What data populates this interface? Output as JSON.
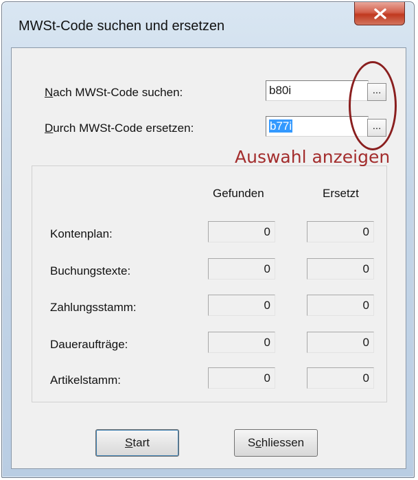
{
  "window": {
    "title": "MWSt-Code suchen und ersetzen",
    "close_icon": "close-icon"
  },
  "search": {
    "label_accel": "N",
    "label_rest": "ach MWSt-Code suchen:",
    "value": "b80i",
    "browse_label": "..."
  },
  "replace": {
    "label_accel": "D",
    "label_rest": "urch MWSt-Code ersetzen:",
    "value": "b77i",
    "browse_label": "..."
  },
  "annotation": {
    "text": "Auswahl anzeigen",
    "color": "#a32d2d"
  },
  "results": {
    "col_found": "Gefunden",
    "col_replaced": "Ersetzt",
    "rows": [
      {
        "label": "Kontenplan:",
        "found": "0",
        "replaced": "0"
      },
      {
        "label": "Buchungstexte:",
        "found": "0",
        "replaced": "0"
      },
      {
        "label": "Zahlungsstamm:",
        "found": "0",
        "replaced": "0"
      },
      {
        "label": "Daueraufträge:",
        "found": "0",
        "replaced": "0"
      },
      {
        "label": "Artikelstamm:",
        "found": "0",
        "replaced": "0"
      }
    ]
  },
  "buttons": {
    "start_accel": "S",
    "start_rest": "tart",
    "close_pre": "S",
    "close_accel": "c",
    "close_rest": "hliessen"
  }
}
